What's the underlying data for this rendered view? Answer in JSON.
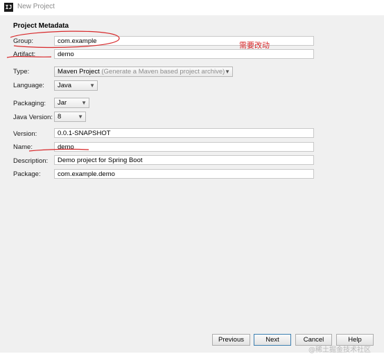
{
  "window": {
    "title": "New Project",
    "app_icon": "intellij-logo-icon"
  },
  "section_title": "Project Metadata",
  "fields": {
    "group": {
      "label": "Group:",
      "value": "com.example"
    },
    "artifact": {
      "label": "Artifact:",
      "value": "demo"
    },
    "type": {
      "label": "Type:",
      "value": "Maven Project",
      "hint": "(Generate a Maven based project archive)"
    },
    "language": {
      "label": "Language:",
      "value": "Java"
    },
    "packaging": {
      "label": "Packaging:",
      "value": "Jar"
    },
    "java_version": {
      "label": "Java Version:",
      "value": "8"
    },
    "version": {
      "label": "Version:",
      "value": "0.0.1-SNAPSHOT"
    },
    "name": {
      "label": "Name:",
      "value": "demo"
    },
    "description": {
      "label": "Description:",
      "value": "Demo project for Spring Boot"
    },
    "package": {
      "label": "Package:",
      "value": "com.example.demo"
    }
  },
  "annotation": {
    "text": "需要改动",
    "color": "#d8282a"
  },
  "buttons": {
    "previous": "Previous",
    "next": "Next",
    "cancel": "Cancel",
    "help": "Help"
  },
  "watermark": "@稀土掘金技术社区"
}
